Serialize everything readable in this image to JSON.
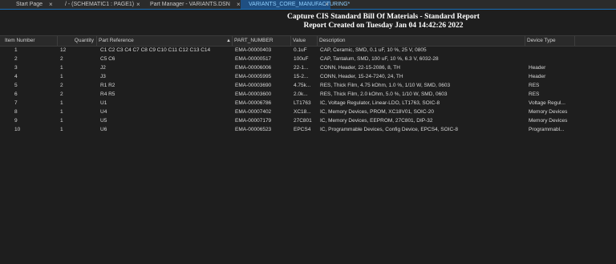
{
  "tabs": [
    {
      "label": "Start Page",
      "close": "×"
    },
    {
      "label": "/ - (SCHEMATIC1 : PAGE1)",
      "close": "×"
    },
    {
      "label": "Part Manager - VARIANTS.DSN",
      "close": "×"
    },
    {
      "label": "VARIANTS_CORE_MANUFACTURING*",
      "close": "×"
    }
  ],
  "report": {
    "title": "Capture CIS Standard Bill Of Materials - Standard Report",
    "subtitle": "Report Created on Tuesday Jan 04 14:42:26 2022"
  },
  "columns": {
    "item": "Item Number",
    "qty": "Quantity",
    "ref": "Part Reference",
    "pn": "PART_NUMBER",
    "val": "Value",
    "desc": "Description",
    "type": "Device Type",
    "sort_arrow": "▲"
  },
  "rows": [
    {
      "item": "1",
      "qty": "12",
      "ref": "C1 C2 C3 C4 C7 C8 C9 C10 C11 C12 C13 C14",
      "pn": "EMA-00000403",
      "val": "0.1uF",
      "desc": "CAP, Ceramic, SMD, 0.1 uF, 10 %, 25 V, 0805",
      "type": ""
    },
    {
      "item": "2",
      "qty": "2",
      "ref": "C5 C6",
      "pn": "EMA-00000517",
      "val": "100uF",
      "desc": "CAP, Tantalum, SMD, 100 uF, 10 %, 6.3 V, 6032-28",
      "type": ""
    },
    {
      "item": "3",
      "qty": "1",
      "ref": "J2",
      "pn": "EMA-00006006",
      "val": "22-1...",
      "desc": "CONN, Header, 22-15-2086, 8, TH",
      "type": "Header"
    },
    {
      "item": "4",
      "qty": "1",
      "ref": "J3",
      "pn": "EMA-00005995",
      "val": "15-2...",
      "desc": "CONN, Header, 15-24-7240, 24, TH",
      "type": "Header"
    },
    {
      "item": "5",
      "qty": "2",
      "ref": "R1 R2",
      "pn": "EMA-00003690",
      "val": "4.75k...",
      "desc": "RES, Thick Film, 4.75 kOhm, 1.0 %, 1/10 W, SMD, 0603",
      "type": "RES"
    },
    {
      "item": "6",
      "qty": "2",
      "ref": "R4 R5",
      "pn": "EMA-00003600",
      "val": "2.0k...",
      "desc": "RES, Thick Film, 2.0 kOhm, 5.0 %, 1/10 W, SMD, 0603",
      "type": "RES"
    },
    {
      "item": "7",
      "qty": "1",
      "ref": "U1",
      "pn": "EMA-00006786",
      "val": "LT1763",
      "desc": "IC, Voltage Regulator, Linear-LDO, LT1763, SOIC-8",
      "type": "Voltage Regul..."
    },
    {
      "item": "8",
      "qty": "1",
      "ref": "U4",
      "pn": "EMA-00007402",
      "val": "XC18...",
      "desc": "IC, Memory Devices, PROM, XC18V01, SOIC-20",
      "type": "Memory Devices"
    },
    {
      "item": "9",
      "qty": "1",
      "ref": "U5",
      "pn": "EMA-00007179",
      "val": "27C801",
      "desc": "IC, Memory Devices, EEPROM, 27C801, DIP-32",
      "type": "Memory Devices"
    },
    {
      "item": "10",
      "qty": "1",
      "ref": "U6",
      "pn": "EMA-00006523",
      "val": "EPCS4",
      "desc": "IC, Programmable Devices, Config Device, EPCS4, SOIC-8",
      "type": "Programmabl..."
    }
  ]
}
